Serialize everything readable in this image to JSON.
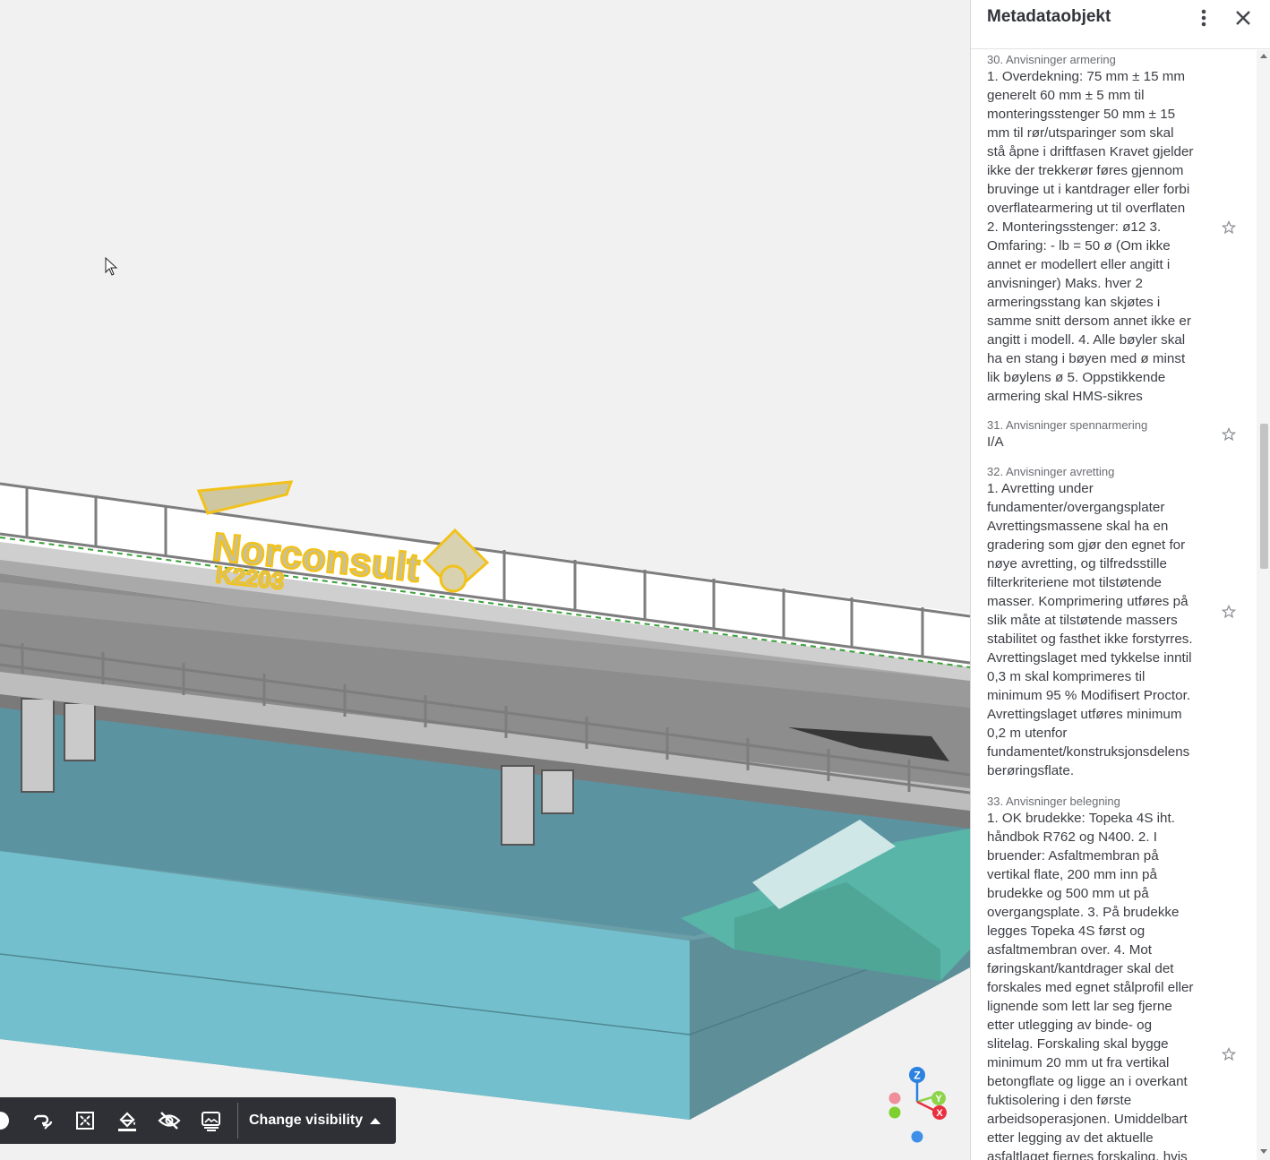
{
  "panel": {
    "title": "Metadataobjekt",
    "menu_icon": "more-vertical-icon",
    "close_icon": "close-icon",
    "properties": [
      {
        "label": "30. Anvisninger armering",
        "lines": [
          "1. Overdekning: 75 mm ± 15 mm",
          "generelt 60 mm ± 5 mm til",
          "monteringsstenger 50 mm ± 15",
          "mm til rør/utsparinger som skal",
          "stå åpne i driftfasen Kravet gjelder",
          "ikke der trekkerør føres gjennom",
          "bruvinge ut i kantdrager eller forbi",
          "overflatearmering ut til overflaten",
          "2. Monteringsstenger: ø12 3.",
          "Omfaring: - lb = 50 ø (Om ikke",
          "annet er modellert eller angitt i",
          "anvisninger) Maks. hver 2",
          "armeringsstang kan skjøtes i",
          "samme snitt dersom annet ikke er",
          "angitt i modell. 4. Alle bøyler skal",
          "ha en stang i bøyen med ø minst",
          "lik bøylens ø 5. Oppstikkende",
          "armering skal HMS-sikres"
        ]
      },
      {
        "label": "31. Anvisninger spennarmering",
        "lines": [
          "I/A"
        ]
      },
      {
        "label": "32. Anvisninger avretting",
        "lines": [
          "1. Avretting under",
          "fundamenter/overgangsplater",
          "Avrettingsmassene skal ha en",
          "gradering som gjør den egnet for",
          "nøye avretting, og tilfredsstille",
          "filterkriteriene mot tilstøtende",
          "masser. Komprimering utføres på",
          "slik måte at tilstøtende massers",
          "stabilitet og fasthet ikke forstyrres.",
          "Avrettingslaget med tykkelse inntil",
          "0,3 m skal komprimeres til",
          "minimum 95 % Modifisert Proctor.",
          "Avrettingslaget utføres minimum",
          "0,2 m utenfor",
          "fundamentet/konstruksjonsdelens",
          "berøringsflate."
        ]
      },
      {
        "label": "33. Anvisninger belegning",
        "lines": [
          "1. OK brudekke: Topeka 4S iht.",
          "håndbok R762 og N400. 2. I",
          "bruender: Asfaltmembran på",
          "vertikal flate, 200 mm inn på",
          "brudekke og 500 mm ut på",
          "overgangsplate. 3. På brudekke",
          "legges Topeka 4S først og",
          "asfaltmembran over. 4. Mot",
          "føringskant/kantdrager skal det",
          "forskales med egnet stålprofil eller",
          "lignende som lett lar seg fjerne",
          "etter utlegging av binde- og",
          "slitelag. Forskaling skal bygge",
          "minimum 20 mm ut fra vertikal",
          "betongflate og ligge an i overkant",
          "fuktisolering i den første",
          "arbeidsoperasjonen. Umiddelbart",
          "etter legging av det aktuelle",
          "asfaltlaget fjernes forskaling, hvis"
        ]
      }
    ]
  },
  "toolbar": {
    "icons": [
      "circle-icon",
      "link-icon",
      "fit-view-icon",
      "paint-bucket-icon",
      "eye-off-icon",
      "image-stack-icon"
    ],
    "visibility_label": "Change visibility",
    "visibility_icon": "caret-up-icon"
  },
  "viewport": {
    "logo_text": "Norconsult",
    "logo_subtext": "K2203",
    "gizmo_labels": {
      "z": "Z",
      "y": "Y",
      "x": "X"
    },
    "colors": {
      "sky": "#f1f1f1",
      "water": "#6fbfcc",
      "water_dark": "#5a8f9a",
      "abutment": "#57b6a8",
      "deck": "#9a9a9a",
      "railing": "#8c8c8c",
      "highlight": "#f2c21a",
      "axis_x": "#e8303e",
      "axis_y": "#8dd44a",
      "axis_z": "#2b82e0"
    }
  }
}
